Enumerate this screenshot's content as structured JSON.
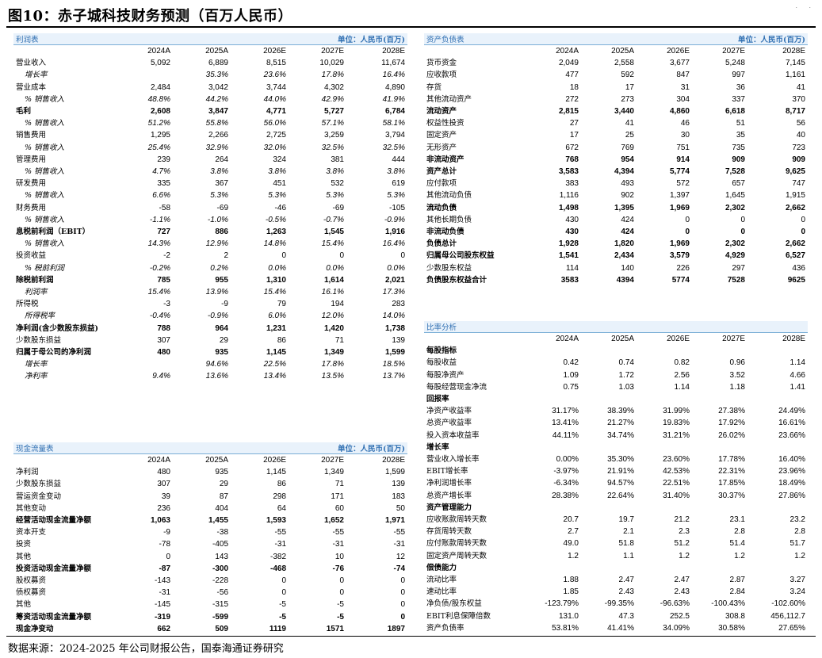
{
  "title": "图10：赤子城科技财务预测（百万人民币）",
  "years": [
    "2024A",
    "2025A",
    "2026E",
    "2027E",
    "2028E"
  ],
  "income": {
    "name": "利润表",
    "unit": "单位：人民币(百万)",
    "rows": [
      {
        "s": "",
        "l": "营业收入",
        "v": [
          "5,092",
          "6,889",
          "8,515",
          "10,029",
          "11,674"
        ]
      },
      {
        "s": "it",
        "l": "增长率",
        "v": [
          "",
          "35.3%",
          "23.6%",
          "17.8%",
          "16.4%"
        ]
      },
      {
        "s": "",
        "l": "营业成本",
        "v": [
          "2,484",
          "3,042",
          "3,744",
          "4,302",
          "4,890"
        ]
      },
      {
        "s": "it",
        "l": "% 销售收入",
        "v": [
          "48.8%",
          "44.2%",
          "44.0%",
          "42.9%",
          "41.9%"
        ]
      },
      {
        "s": "b",
        "l": "毛利",
        "v": [
          "2,608",
          "3,847",
          "4,771",
          "5,727",
          "6,784"
        ]
      },
      {
        "s": "it",
        "l": "% 销售收入",
        "v": [
          "51.2%",
          "55.8%",
          "56.0%",
          "57.1%",
          "58.1%"
        ]
      },
      {
        "s": "",
        "l": "销售费用",
        "v": [
          "1,295",
          "2,266",
          "2,725",
          "3,259",
          "3,794"
        ]
      },
      {
        "s": "it",
        "l": "% 销售收入",
        "v": [
          "25.4%",
          "32.9%",
          "32.0%",
          "32.5%",
          "32.5%"
        ]
      },
      {
        "s": "",
        "l": "管理费用",
        "v": [
          "239",
          "264",
          "324",
          "381",
          "444"
        ]
      },
      {
        "s": "it",
        "l": "% 销售收入",
        "v": [
          "4.7%",
          "3.8%",
          "3.8%",
          "3.8%",
          "3.8%"
        ]
      },
      {
        "s": "",
        "l": "研发费用",
        "v": [
          "335",
          "367",
          "451",
          "532",
          "619"
        ]
      },
      {
        "s": "it",
        "l": "% 销售收入",
        "v": [
          "6.6%",
          "5.3%",
          "5.3%",
          "5.3%",
          "5.3%"
        ]
      },
      {
        "s": "",
        "l": "财务费用",
        "v": [
          "-58",
          "-69",
          "-46",
          "-69",
          "-105"
        ]
      },
      {
        "s": "it",
        "l": "% 销售收入",
        "v": [
          "-1.1%",
          "-1.0%",
          "-0.5%",
          "-0.7%",
          "-0.9%"
        ]
      },
      {
        "s": "b",
        "l": "息税前利润（EBIT）",
        "v": [
          "727",
          "886",
          "1,263",
          "1,545",
          "1,916"
        ]
      },
      {
        "s": "it",
        "l": "% 销售收入",
        "v": [
          "14.3%",
          "12.9%",
          "14.8%",
          "15.4%",
          "16.4%"
        ]
      },
      {
        "s": "",
        "l": "投资收益",
        "v": [
          "-2",
          "2",
          "0",
          "0",
          "0"
        ]
      },
      {
        "s": "it",
        "l": "% 税前利润",
        "v": [
          "-0.2%",
          "0.2%",
          "0.0%",
          "0.0%",
          "0.0%"
        ]
      },
      {
        "s": "b",
        "l": "除税前利润",
        "v": [
          "785",
          "955",
          "1,310",
          "1,614",
          "2,021"
        ]
      },
      {
        "s": "it",
        "l": "利润率",
        "v": [
          "15.4%",
          "13.9%",
          "15.4%",
          "16.1%",
          "17.3%"
        ]
      },
      {
        "s": "",
        "l": "所得税",
        "v": [
          "-3",
          "-9",
          "79",
          "194",
          "283"
        ]
      },
      {
        "s": "it",
        "l": "所得税率",
        "v": [
          "-0.4%",
          "-0.9%",
          "6.0%",
          "12.0%",
          "14.0%"
        ]
      },
      {
        "s": "b",
        "l": "净利润(含少数股东损益)",
        "v": [
          "788",
          "964",
          "1,231",
          "1,420",
          "1,738"
        ]
      },
      {
        "s": "",
        "l": "少数股东损益",
        "v": [
          "307",
          "29",
          "86",
          "71",
          "139"
        ]
      },
      {
        "s": "b",
        "l": "归属于母公司的净利润",
        "v": [
          "480",
          "935",
          "1,145",
          "1,349",
          "1,599"
        ]
      },
      {
        "s": "it",
        "l": "增长率",
        "v": [
          "",
          "94.6%",
          "22.5%",
          "17.8%",
          "18.5%"
        ]
      },
      {
        "s": "it",
        "l": "净利率",
        "v": [
          "9.4%",
          "13.6%",
          "13.4%",
          "13.5%",
          "13.7%"
        ]
      }
    ]
  },
  "balance": {
    "name": "资产负债表",
    "unit": "单位：人民币(百万)",
    "rows": [
      {
        "s": "",
        "l": "货币资金",
        "v": [
          "2,049",
          "2,558",
          "3,677",
          "5,248",
          "7,145"
        ]
      },
      {
        "s": "",
        "l": "应收款项",
        "v": [
          "477",
          "592",
          "847",
          "997",
          "1,161"
        ]
      },
      {
        "s": "",
        "l": "存货",
        "v": [
          "18",
          "17",
          "31",
          "36",
          "41"
        ]
      },
      {
        "s": "",
        "l": "其他流动资产",
        "v": [
          "272",
          "273",
          "304",
          "337",
          "370"
        ]
      },
      {
        "s": "b",
        "l": "流动资产",
        "v": [
          "2,815",
          "3,440",
          "4,860",
          "6,618",
          "8,717"
        ]
      },
      {
        "s": "",
        "l": "权益性投资",
        "v": [
          "27",
          "41",
          "46",
          "51",
          "56"
        ]
      },
      {
        "s": "",
        "l": "固定资产",
        "v": [
          "17",
          "25",
          "30",
          "35",
          "40"
        ]
      },
      {
        "s": "",
        "l": "无形资产",
        "v": [
          "672",
          "769",
          "751",
          "735",
          "723"
        ]
      },
      {
        "s": "b",
        "l": "非流动资产",
        "v": [
          "768",
          "954",
          "914",
          "909",
          "909"
        ]
      },
      {
        "s": "b",
        "l": "资产总计",
        "v": [
          "3,583",
          "4,394",
          "5,774",
          "7,528",
          "9,625"
        ]
      },
      {
        "s": "",
        "l": "应付款项",
        "v": [
          "383",
          "493",
          "572",
          "657",
          "747"
        ]
      },
      {
        "s": "",
        "l": "其他流动负债",
        "v": [
          "1,116",
          "902",
          "1,397",
          "1,645",
          "1,915"
        ]
      },
      {
        "s": "b",
        "l": "流动负债",
        "v": [
          "1,498",
          "1,395",
          "1,969",
          "2,302",
          "2,662"
        ]
      },
      {
        "s": "",
        "l": "其他长期负债",
        "v": [
          "430",
          "424",
          "0",
          "0",
          "0"
        ]
      },
      {
        "s": "b",
        "l": "非流动负债",
        "v": [
          "430",
          "424",
          "0",
          "0",
          "0"
        ]
      },
      {
        "s": "b",
        "l": "负债总计",
        "v": [
          "1,928",
          "1,820",
          "1,969",
          "2,302",
          "2,662"
        ]
      },
      {
        "s": "b",
        "l": "归属母公司股东权益",
        "v": [
          "1,541",
          "2,434",
          "3,579",
          "4,929",
          "6,527"
        ]
      },
      {
        "s": "",
        "l": "少数股东权益",
        "v": [
          "114",
          "140",
          "226",
          "297",
          "436"
        ]
      },
      {
        "s": "b",
        "l": "负债股东权益合计",
        "v": [
          "3583",
          "4394",
          "5774",
          "7528",
          "9625"
        ]
      }
    ]
  },
  "cashflow": {
    "name": "现金流量表",
    "unit": "单位：人民币(百万)",
    "rows": [
      {
        "s": "",
        "l": "净利润",
        "v": [
          "480",
          "935",
          "1,145",
          "1,349",
          "1,599"
        ]
      },
      {
        "s": "",
        "l": "少数股东损益",
        "v": [
          "307",
          "29",
          "86",
          "71",
          "139"
        ]
      },
      {
        "s": "",
        "l": "营运资金变动",
        "v": [
          "39",
          "87",
          "298",
          "171",
          "183"
        ]
      },
      {
        "s": "",
        "l": "其他变动",
        "v": [
          "236",
          "404",
          "64",
          "60",
          "50"
        ]
      },
      {
        "s": "b",
        "l": "经营活动现金流量净额",
        "v": [
          "1,063",
          "1,455",
          "1,593",
          "1,652",
          "1,971"
        ]
      },
      {
        "s": "",
        "l": "资本开支",
        "v": [
          "-9",
          "-38",
          "-55",
          "-55",
          "-55"
        ]
      },
      {
        "s": "",
        "l": "投资",
        "v": [
          "-78",
          "-405",
          "-31",
          "-31",
          "-31"
        ]
      },
      {
        "s": "",
        "l": "其他",
        "v": [
          "0",
          "143",
          "-382",
          "10",
          "12"
        ]
      },
      {
        "s": "b",
        "l": "投资活动现金流量净额",
        "v": [
          "-87",
          "-300",
          "-468",
          "-76",
          "-74"
        ]
      },
      {
        "s": "",
        "l": "股权募资",
        "v": [
          "-143",
          "-228",
          "0",
          "0",
          "0"
        ]
      },
      {
        "s": "",
        "l": "债权募资",
        "v": [
          "-31",
          "-56",
          "0",
          "0",
          "0"
        ]
      },
      {
        "s": "",
        "l": "其他",
        "v": [
          "-145",
          "-315",
          "-5",
          "-5",
          "0"
        ]
      },
      {
        "s": "b",
        "l": "筹资活动现金流量净额",
        "v": [
          "-319",
          "-599",
          "-5",
          "-5",
          "0"
        ]
      },
      {
        "s": "b",
        "l": "现金净变动",
        "v": [
          "662",
          "509",
          "1119",
          "1571",
          "1897"
        ]
      }
    ]
  },
  "ratio": {
    "name": "比率分析",
    "rows": [
      {
        "s": "b",
        "l": "每股指标",
        "v": [
          "",
          "",
          "",
          "",
          ""
        ]
      },
      {
        "s": "",
        "l": "每股收益",
        "v": [
          "0.42",
          "0.74",
          "0.82",
          "0.96",
          "1.14"
        ]
      },
      {
        "s": "",
        "l": "每股净资产",
        "v": [
          "1.09",
          "1.72",
          "2.56",
          "3.52",
          "4.66"
        ]
      },
      {
        "s": "",
        "l": "每股经营现金净流",
        "v": [
          "0.75",
          "1.03",
          "1.14",
          "1.18",
          "1.41"
        ]
      },
      {
        "s": "b",
        "l": "回报率",
        "v": [
          "",
          "",
          "",
          "",
          ""
        ]
      },
      {
        "s": "",
        "l": "净资产收益率",
        "v": [
          "31.17%",
          "38.39%",
          "31.99%",
          "27.38%",
          "24.49%"
        ]
      },
      {
        "s": "",
        "l": "总资产收益率",
        "v": [
          "13.41%",
          "21.27%",
          "19.83%",
          "17.92%",
          "16.61%"
        ]
      },
      {
        "s": "",
        "l": "投入资本收益率",
        "v": [
          "44.11%",
          "34.74%",
          "31.21%",
          "26.02%",
          "23.66%"
        ]
      },
      {
        "s": "b",
        "l": "增长率",
        "v": [
          "",
          "",
          "",
          "",
          ""
        ]
      },
      {
        "s": "",
        "l": "营业收入增长率",
        "v": [
          "0.00%",
          "35.30%",
          "23.60%",
          "17.78%",
          "16.40%"
        ]
      },
      {
        "s": "",
        "l": "EBIT增长率",
        "v": [
          "-3.97%",
          "21.91%",
          "42.53%",
          "22.31%",
          "23.96%"
        ]
      },
      {
        "s": "",
        "l": "净利润增长率",
        "v": [
          "-6.34%",
          "94.57%",
          "22.51%",
          "17.85%",
          "18.49%"
        ]
      },
      {
        "s": "",
        "l": "总资产增长率",
        "v": [
          "28.38%",
          "22.64%",
          "31.40%",
          "30.37%",
          "27.86%"
        ]
      },
      {
        "s": "b",
        "l": "资产管理能力",
        "v": [
          "",
          "",
          "",
          "",
          ""
        ]
      },
      {
        "s": "",
        "l": "应收账款周转天数",
        "v": [
          "20.7",
          "19.7",
          "21.2",
          "23.1",
          "23.2"
        ]
      },
      {
        "s": "",
        "l": "存货周转天数",
        "v": [
          "2.7",
          "2.1",
          "2.3",
          "2.8",
          "2.8"
        ]
      },
      {
        "s": "",
        "l": "应付账款周转天数",
        "v": [
          "49.0",
          "51.8",
          "51.2",
          "51.4",
          "51.7"
        ]
      },
      {
        "s": "",
        "l": "固定资产周转天数",
        "v": [
          "1.2",
          "1.1",
          "1.2",
          "1.2",
          "1.2"
        ]
      },
      {
        "s": "b",
        "l": "偿债能力",
        "v": [
          "",
          "",
          "",
          "",
          ""
        ]
      },
      {
        "s": "",
        "l": "流动比率",
        "v": [
          "1.88",
          "2.47",
          "2.47",
          "2.87",
          "3.27"
        ]
      },
      {
        "s": "",
        "l": "速动比率",
        "v": [
          "1.85",
          "2.43",
          "2.43",
          "2.84",
          "3.24"
        ]
      },
      {
        "s": "",
        "l": "净负债/股东权益",
        "v": [
          "-123.79%",
          "-99.35%",
          "-96.63%",
          "-100.43%",
          "-102.60%"
        ]
      },
      {
        "s": "",
        "l": "EBIT利息保障倍数",
        "v": [
          "131.0",
          "47.3",
          "252.5",
          "308.8",
          "456,112.7"
        ]
      },
      {
        "s": "",
        "l": "资产负债率",
        "v": [
          "53.81%",
          "41.41%",
          "34.09%",
          "30.58%",
          "27.65%"
        ]
      }
    ]
  },
  "source": "数据来源：2024-2025 年公司财报公告，国泰海通证券研究"
}
